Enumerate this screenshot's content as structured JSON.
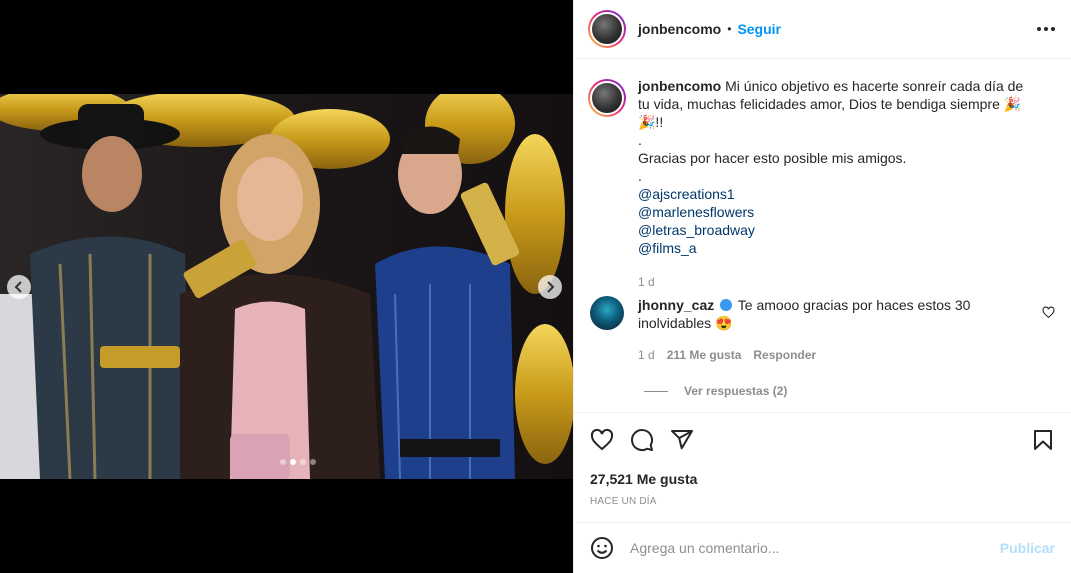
{
  "header": {
    "username": "jonbencomo",
    "separator": "•",
    "follow_label": "Seguir"
  },
  "caption": {
    "username": "jonbencomo",
    "line1": "Mi único objetivo es hacerte sonreír cada día de tu vida, muchas felicidades amor, Dios te bendiga siempre 🎉🎉!!",
    "dot1": ".",
    "line2": "Gracias por hacer esto posible mis amigos.",
    "dot2": ".",
    "tags": [
      "@ajscreations1",
      "@marlenesflowers",
      "@letras_broadway",
      "@films_a"
    ],
    "time": "1 d"
  },
  "comment": {
    "username": "jhonny_caz",
    "text": "Te amooo gracias por haces estos 30 inolvidables 😍",
    "time": "1 d",
    "likes": "211 Me gusta",
    "reply_label": "Responder",
    "view_replies": "Ver respuestas (2)"
  },
  "post": {
    "likes": "27,521 Me gusta",
    "ago": "HACE UN DÍA"
  },
  "add_comment": {
    "placeholder": "Agrega un comentario...",
    "publish_label": "Publicar"
  },
  "carousel": {
    "slide_count": 4,
    "active_index": 1
  },
  "colors": {
    "accent": "#0095f6",
    "publish_disabled": "#b2dffc",
    "tag": "#00376b"
  },
  "icons": [
    "more-options-icon",
    "heart-icon",
    "comment-icon",
    "share-icon",
    "bookmark-icon",
    "emoji-icon",
    "chevron-left-icon",
    "chevron-right-icon",
    "verified-icon"
  ]
}
